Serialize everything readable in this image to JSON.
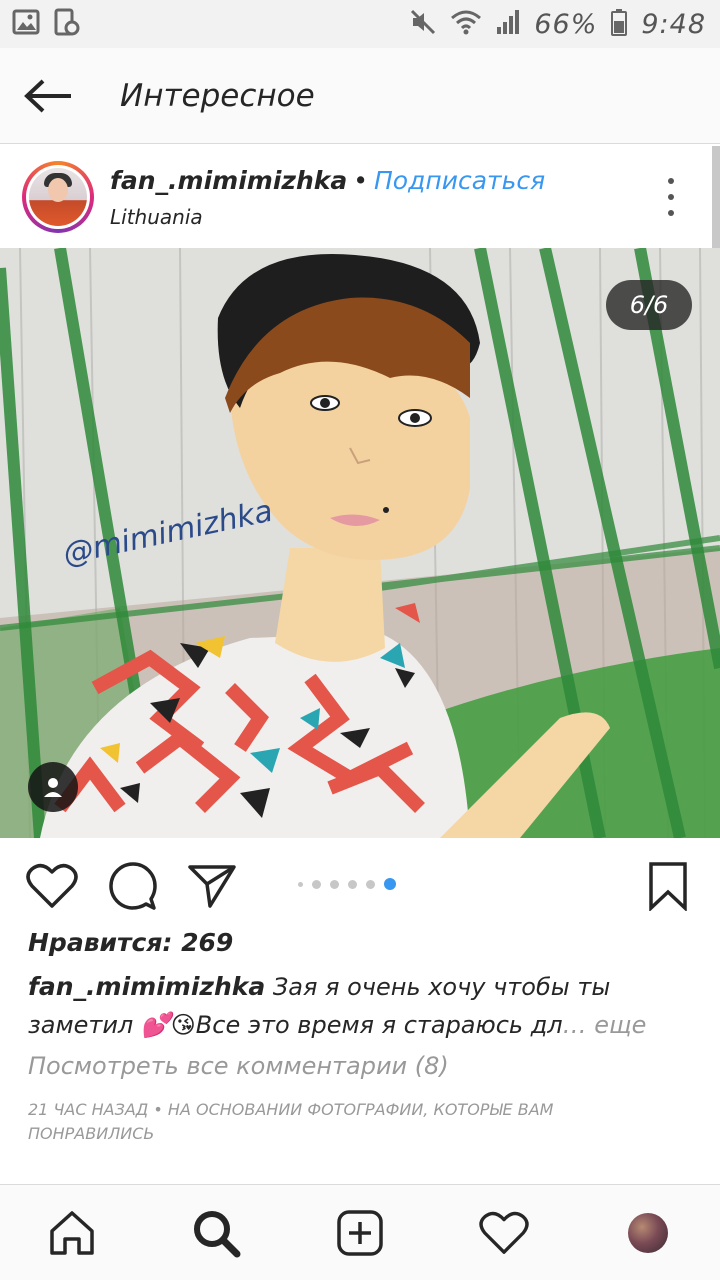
{
  "status_bar": {
    "battery": "66%",
    "time": "9:48"
  },
  "app_bar": {
    "title": "Интересное"
  },
  "post": {
    "username": "fan_.mimimizhka",
    "follow_label": "Подписаться",
    "location": "Lithuania",
    "counter": "6/6",
    "image_watermark": "@mimimizhka",
    "carousel": {
      "total": 6,
      "active": 6
    },
    "likes": "Нравится: 269",
    "caption": "Зая я очень хочу чтобы ты заметил 💕😘Все это время я стараюсь дл",
    "caption_more": "… еще",
    "view_comments": "Посмотреть все комментарии (8)",
    "timestamp": "21 час назад • на основании фотографии, которые вам понравились"
  },
  "icons": {
    "back": "arrow-left-icon",
    "like": "heart-icon",
    "comment": "comment-icon",
    "share": "send-icon",
    "save": "bookmark-icon",
    "tag": "person-icon"
  },
  "colors": {
    "link": "#3897f0",
    "muted": "#999999",
    "text": "#262626"
  }
}
